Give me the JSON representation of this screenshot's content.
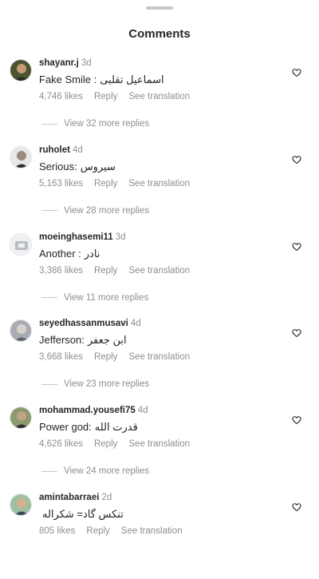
{
  "header": {
    "title": "Comments"
  },
  "comments": [
    {
      "user": "shayanr.j",
      "time": "3d",
      "text_en": "Fake Smile :",
      "text_fa": "اسماعیل تقلبی",
      "likes": "4,746 likes",
      "reply": "Reply",
      "translate": "See translation",
      "more_replies": "View 32 more replies",
      "avatar_color": "#5a4a3a"
    },
    {
      "user": "ruholet",
      "time": "4d",
      "text_en": "Serious:",
      "text_fa": "سیروس",
      "likes": "5,163 likes",
      "reply": "Reply",
      "translate": "See translation",
      "more_replies": "View 28 more replies",
      "avatar_color": "#3a3a3a"
    },
    {
      "user": "moeinghasemi11",
      "time": "3d",
      "text_en": "Another :",
      "text_fa": "نادر",
      "likes": "3,386 likes",
      "reply": "Reply",
      "translate": "See translation",
      "more_replies": "View 11 more replies",
      "avatar_color": "#d9dde2"
    },
    {
      "user": "seyedhassanmusavi",
      "time": "4d",
      "text_en": "Jefferson:",
      "text_fa": "ابن جعفر",
      "likes": "3,668 likes",
      "reply": "Reply",
      "translate": "See translation",
      "more_replies": "View 23 more replies",
      "avatar_color": "#8f959a"
    },
    {
      "user": "mohammad.yousefi75",
      "time": "4d",
      "text_en": "Power god:",
      "text_fa": "قدرت الله",
      "likes": "4,626 likes",
      "reply": "Reply",
      "translate": "See translation",
      "more_replies": "View 24 more replies",
      "avatar_color": "#6b7a54"
    },
    {
      "user": "amintabarraei",
      "time": "2d",
      "text_en": "",
      "text_fa": "تنکس گاد= شکراله",
      "likes": "805 likes",
      "reply": "Reply",
      "translate": "See translation",
      "more_replies": "",
      "avatar_color": "#7da07a"
    }
  ],
  "icons": {
    "like": "heart-outline-icon"
  }
}
